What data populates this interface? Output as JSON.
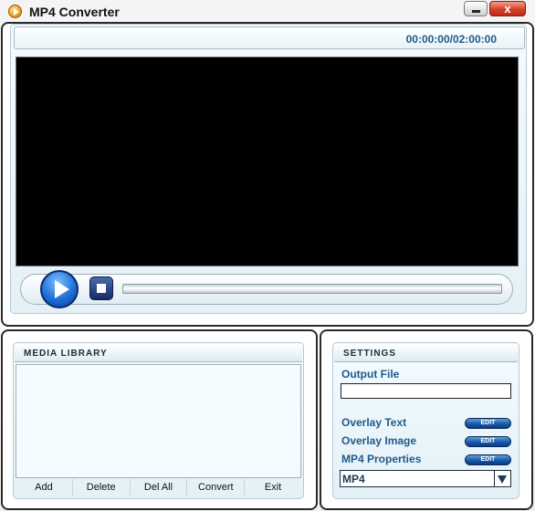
{
  "window": {
    "title": "MP4 Converter",
    "close_label": "x"
  },
  "player": {
    "timecode": "00:00:00/02:00:00"
  },
  "media_library": {
    "header": "MEDIA LIBRARY",
    "buttons": [
      "Add",
      "Delete",
      "Del All",
      "Convert",
      "Exit"
    ]
  },
  "settings": {
    "header": "SETTINGS",
    "output_file_label": "Output File",
    "output_file_value": "",
    "overlay_text_label": "Overlay Text",
    "overlay_image_label": "Overlay Image",
    "mp4_properties_label": "MP4 Properties",
    "edit_label": "EDIT",
    "format_value": "MP4"
  }
}
